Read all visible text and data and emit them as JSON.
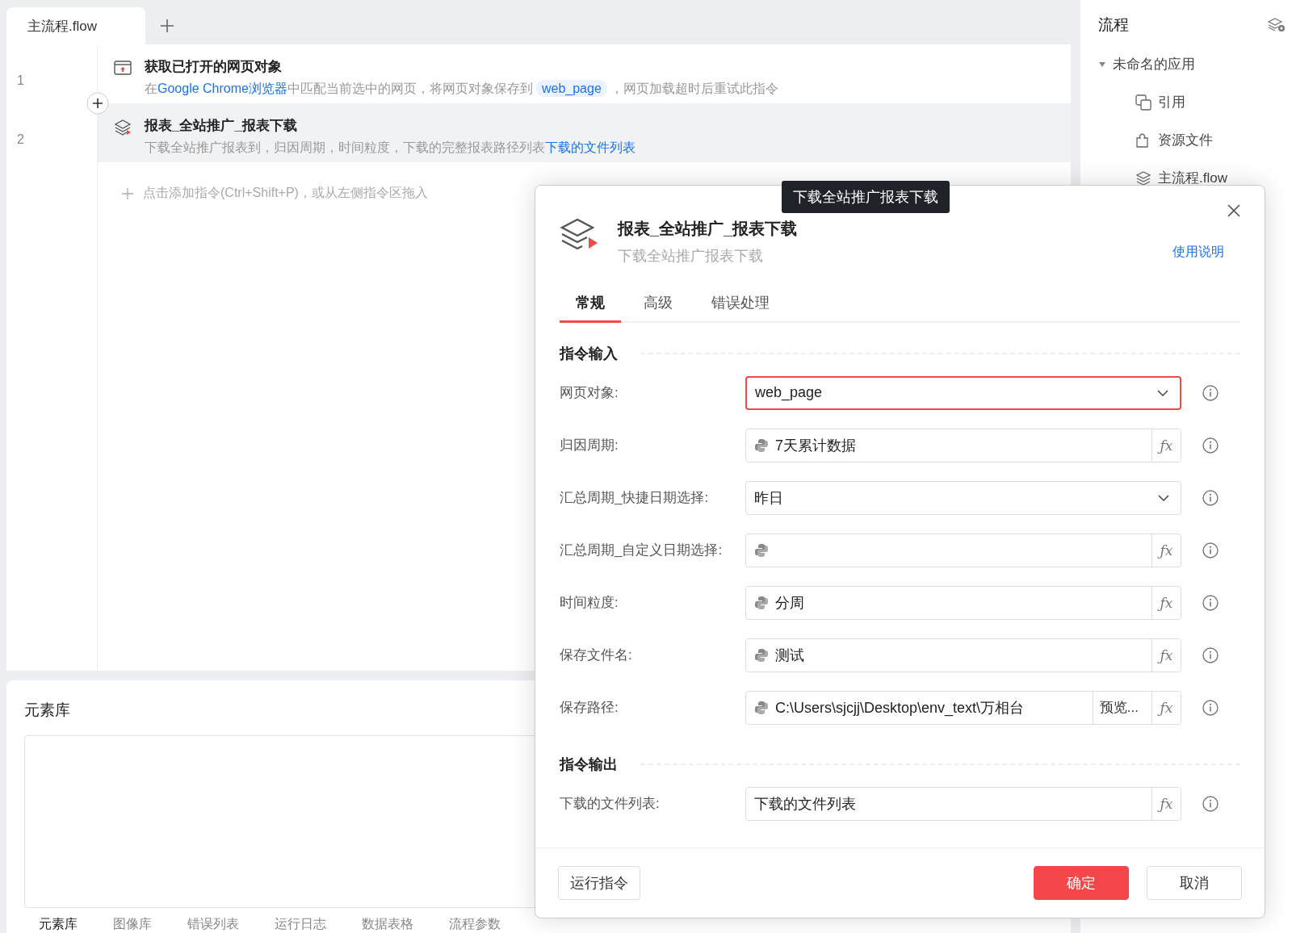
{
  "tabs": [
    {
      "label": "主流程.flow",
      "selected": true
    }
  ],
  "steps": [
    {
      "number": "1",
      "kind": "browser",
      "title": "获取已打开的网页对象",
      "selected": false,
      "description": [
        {
          "kind": "plain",
          "text": "在"
        },
        {
          "kind": "link",
          "text": "Google Chrome浏览器"
        },
        {
          "kind": "plain",
          "text": "中匹配当前选中的网页，将网页对象保存到"
        },
        {
          "kind": "chip",
          "text": "web_page"
        },
        {
          "kind": "plain",
          "text": "，网页加载超时后重试此指令"
        }
      ]
    },
    {
      "number": "2",
      "kind": "layers",
      "title": "报表_全站推广_报表下载",
      "selected": true,
      "description": [
        {
          "kind": "plain",
          "text": "下载全站推广报表到，归因周期，时间粒度，下载的完整报表路径列表"
        },
        {
          "kind": "link",
          "text": "下载的文件列表"
        }
      ]
    }
  ],
  "add_hint": "点击添加指令(Ctrl+Shift+P)，或从左侧指令区拖入",
  "bottom_panel": {
    "title": "元素库",
    "tabs": [
      {
        "label": "元素库",
        "selected": true
      },
      {
        "label": "图像库",
        "selected": false
      },
      {
        "label": "错误列表",
        "selected": false
      },
      {
        "label": "运行日志",
        "selected": false
      },
      {
        "label": "数据表格",
        "selected": false
      },
      {
        "label": "流程参数",
        "selected": false
      }
    ]
  },
  "sidebar": {
    "title": "流程",
    "tree": [
      {
        "label": "未命名的应用",
        "expanded": true,
        "children": [
          {
            "label": "引用",
            "kind": "reference"
          },
          {
            "label": "资源文件",
            "kind": "resource"
          },
          {
            "label": "主流程.flow",
            "kind": "flow"
          }
        ]
      }
    ]
  },
  "dialog": {
    "tooltip": "下载全站推广报表下载",
    "title": "报表_全站推广_报表下载",
    "subtitle": "下载全站推广报表下载",
    "help_link": "使用说明",
    "tabs": [
      {
        "label": "常规",
        "selected": true
      },
      {
        "label": "高级",
        "selected": false
      },
      {
        "label": "错误处理",
        "selected": false
      }
    ],
    "sections": [
      {
        "heading": "指令输入",
        "fields": [
          {
            "label": "网页对象:",
            "kind": "select",
            "value": "web_page",
            "invalid": true
          },
          {
            "label": "归因周期:",
            "kind": "expression",
            "value": "7天累计数据",
            "fx": "ƒx",
            "invalid": false
          },
          {
            "label": "汇总周期_快捷日期选择:",
            "kind": "select",
            "value": "昨日",
            "invalid": false
          },
          {
            "label": "汇总周期_自定义日期选择:",
            "kind": "expression",
            "fx": "ƒx",
            "invalid": false
          },
          {
            "label": "时间粒度:",
            "kind": "expression",
            "value": "分周",
            "fx": "ƒx",
            "invalid": false
          },
          {
            "label": "保存文件名:",
            "kind": "expression",
            "value": "测试",
            "fx": "ƒx",
            "invalid": false
          },
          {
            "label": "保存路径:",
            "kind": "path",
            "value": "C:\\Users\\sjcjj\\Desktop\\env_text\\万相台",
            "browse": "预览...",
            "fx": "ƒx",
            "invalid": false
          }
        ]
      },
      {
        "heading": "指令输出",
        "fields": [
          {
            "label": "下载的文件列表:",
            "kind": "variable",
            "value": "下载的文件列表",
            "fx": "ƒx",
            "invalid": false
          }
        ]
      }
    ],
    "buttons": {
      "run": "运行指令",
      "confirm": "确定",
      "cancel": "取消"
    }
  }
}
